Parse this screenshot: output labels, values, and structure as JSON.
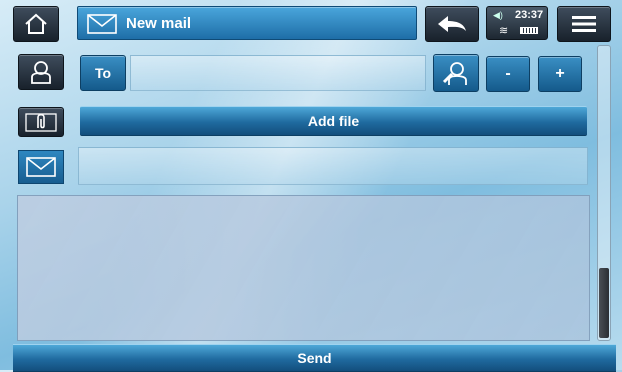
{
  "header": {
    "title": "New mail",
    "status_time": "23:37"
  },
  "compose": {
    "to_label": "To",
    "to_value": "",
    "subject_value": "",
    "body_value": "",
    "minus_label": "-",
    "plus_label": "+",
    "add_file_label": "Add file"
  },
  "footer": {
    "send_label": "Send"
  },
  "icons": {
    "home": "home-icon",
    "mail": "envelope-icon",
    "back": "back-arrow-icon",
    "menu": "menu-icon",
    "contact": "contact-icon",
    "search_contact": "search-contact-icon",
    "attachment": "paperclip-icon",
    "subject": "envelope-icon"
  },
  "colors": {
    "accent": "#1e6ea7",
    "dark_button": "#18212b"
  }
}
